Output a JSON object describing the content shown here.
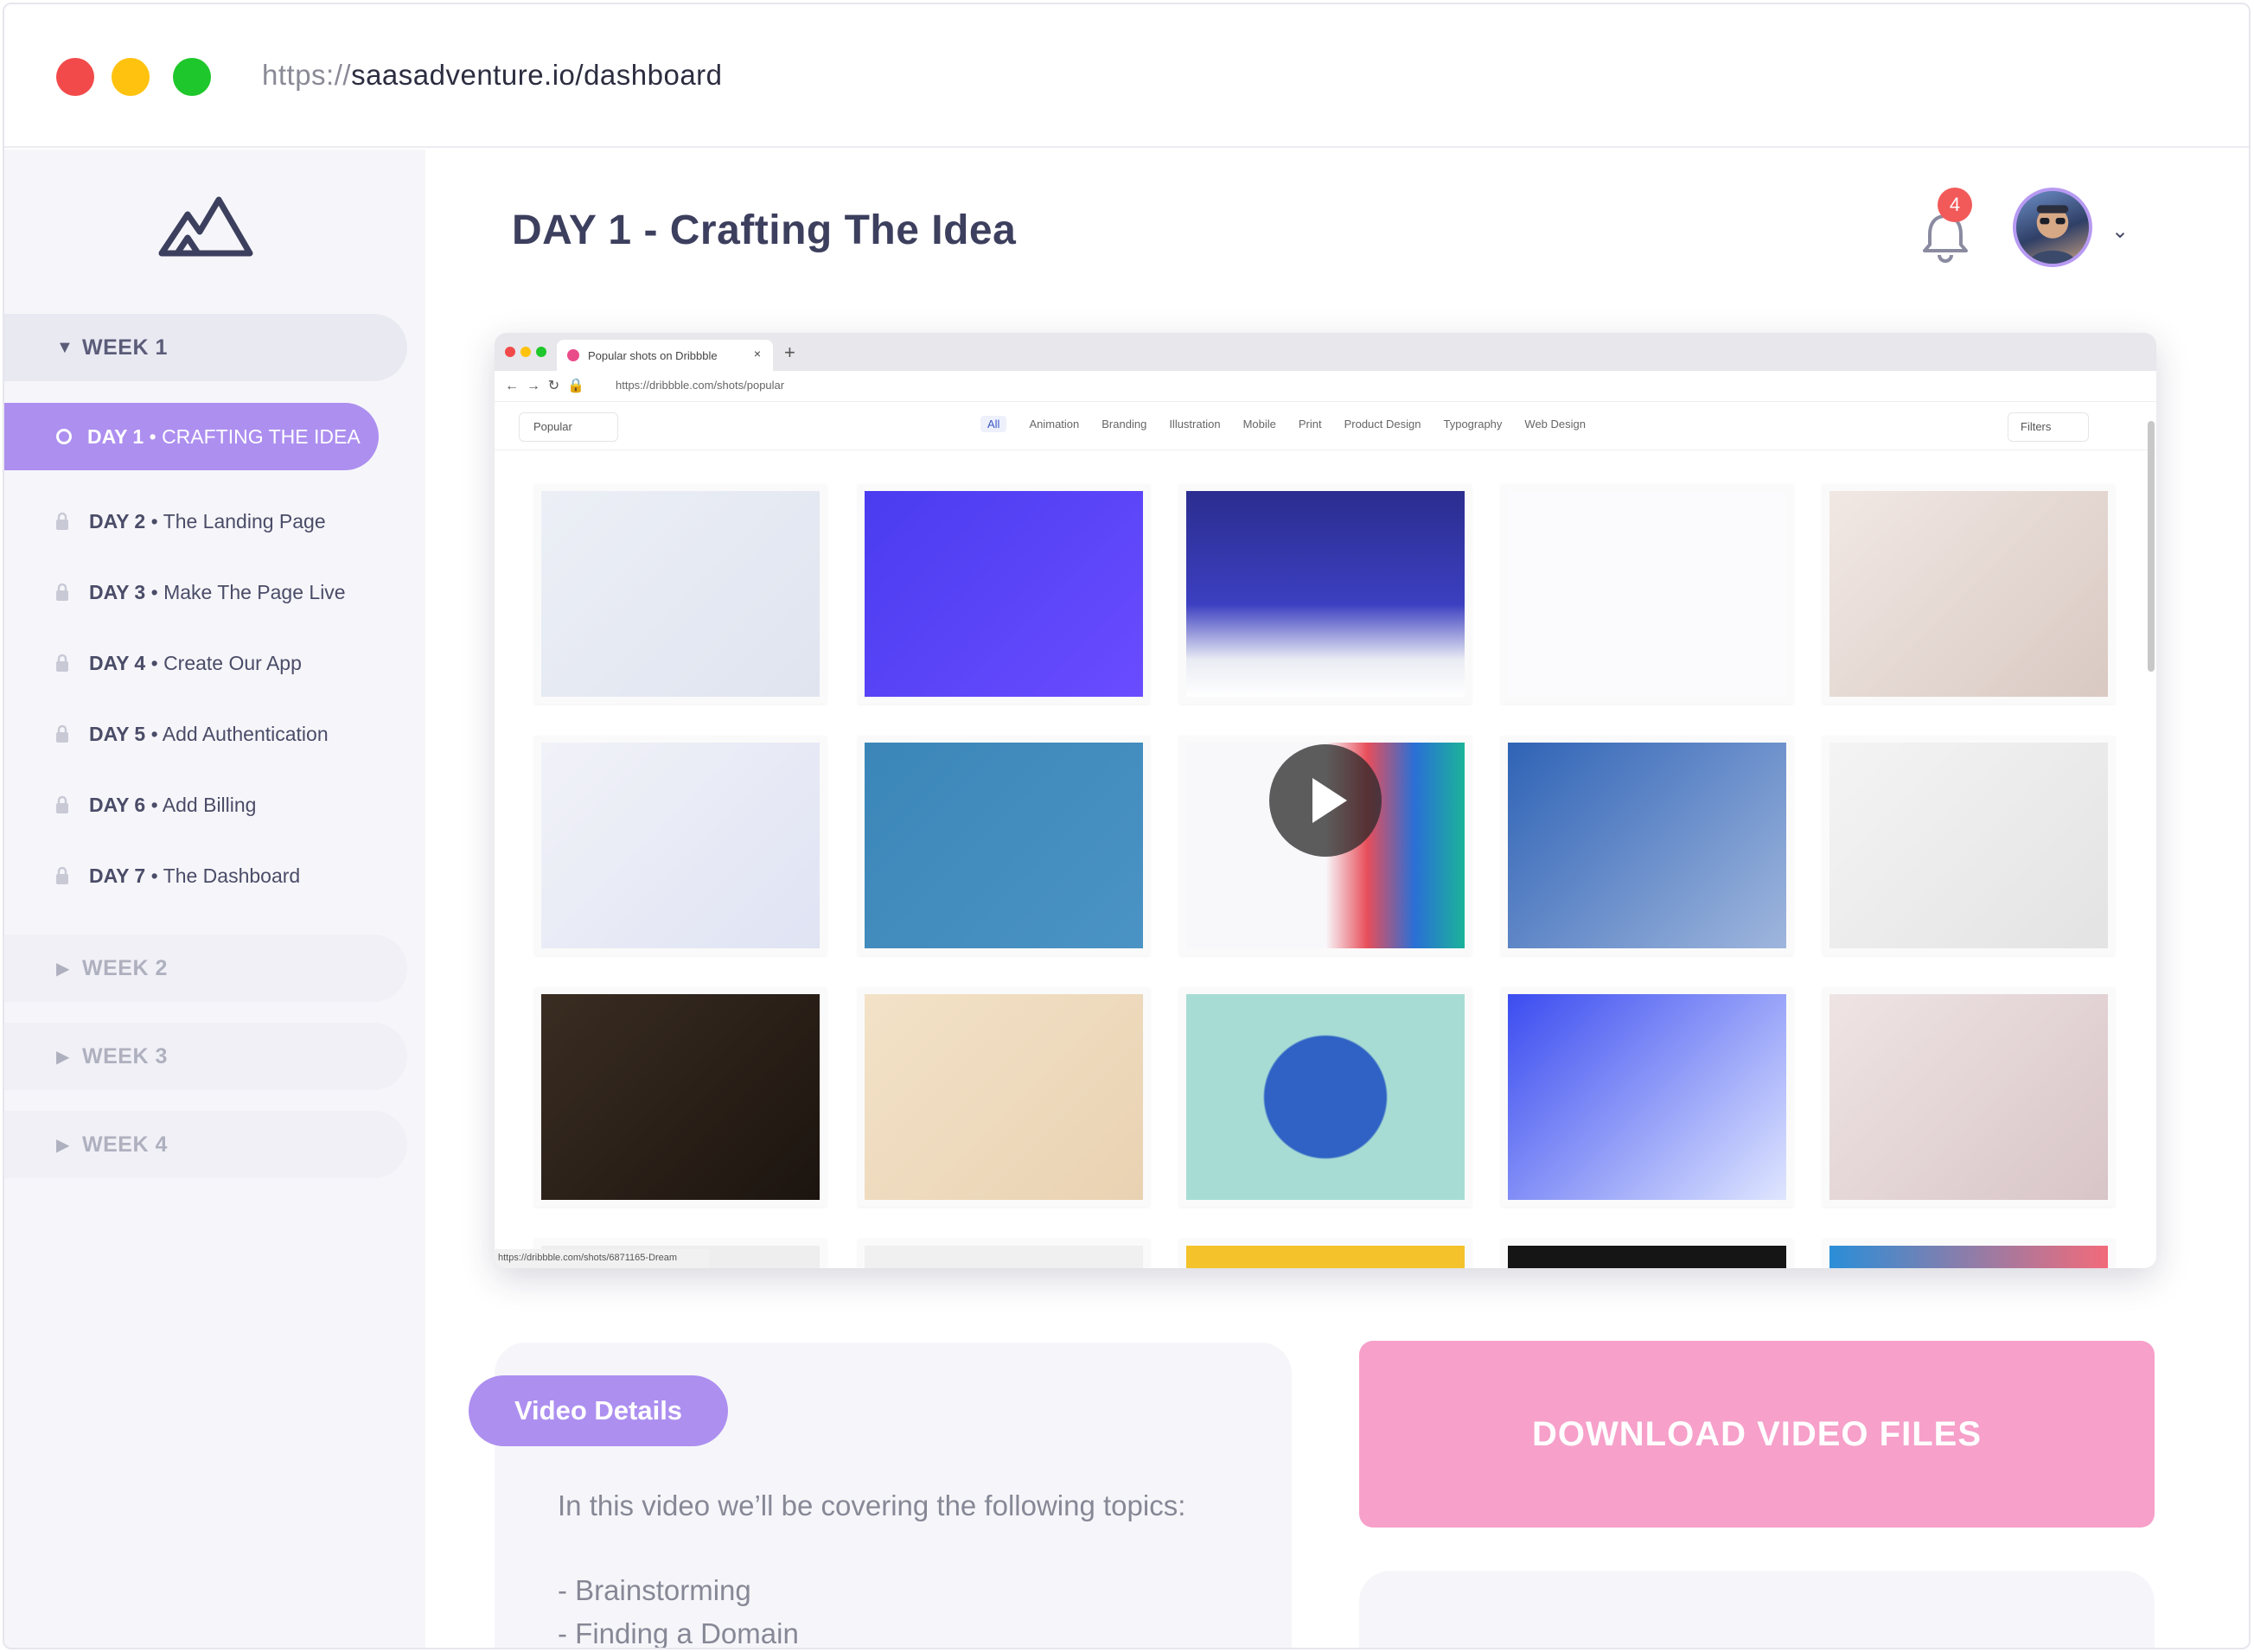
{
  "browser": {
    "url_scheme": "https://",
    "url_path": "saasadventure.io/dashboard"
  },
  "sidebar": {
    "weeks": [
      {
        "label": "WEEK 1",
        "expanded": true
      },
      {
        "label": "WEEK 2",
        "expanded": false
      },
      {
        "label": "WEEK 3",
        "expanded": false
      },
      {
        "label": "WEEK 4",
        "expanded": false
      }
    ],
    "active_day": {
      "prefix": "DAY 1",
      "sep": " • ",
      "label": "CRAFTING THE IDEA"
    },
    "days": [
      {
        "prefix": "DAY 2",
        "label": "The Landing Page"
      },
      {
        "prefix": "DAY 3",
        "label": "Make The Page Live"
      },
      {
        "prefix": "DAY 4",
        "label": "Create Our App"
      },
      {
        "prefix": "DAY 5",
        "label": "Add Authentication"
      },
      {
        "prefix": "DAY 6",
        "label": "Add Billing"
      },
      {
        "prefix": "DAY 7",
        "label": "The Dashboard"
      }
    ],
    "day_sep": " • "
  },
  "header": {
    "title": "DAY 1 - Crafting The Idea",
    "notification_count": "4"
  },
  "video": {
    "tab_title": "Popular shots on Dribbble",
    "url": "https://dribbble.com/shots/popular",
    "popular_label": "Popular",
    "categories": [
      "All",
      "Animation",
      "Branding",
      "Illustration",
      "Mobile",
      "Print",
      "Product Design",
      "Typography",
      "Web Design"
    ],
    "filters_label": "Filters",
    "status_url": "https://dribbble.com/shots/6871165-Dream"
  },
  "details": {
    "tab_label": "Video Details",
    "intro": "In this video we’ll be covering the following topics:",
    "topics": [
      "- Brainstorming",
      "- Finding a Domain"
    ]
  },
  "download_label": "DOWNLOAD VIDEO FILES",
  "colors": {
    "accent_purple": "#ad8ff0",
    "download_pink": "#f6a0ca",
    "badge_red": "#f25a5a"
  }
}
